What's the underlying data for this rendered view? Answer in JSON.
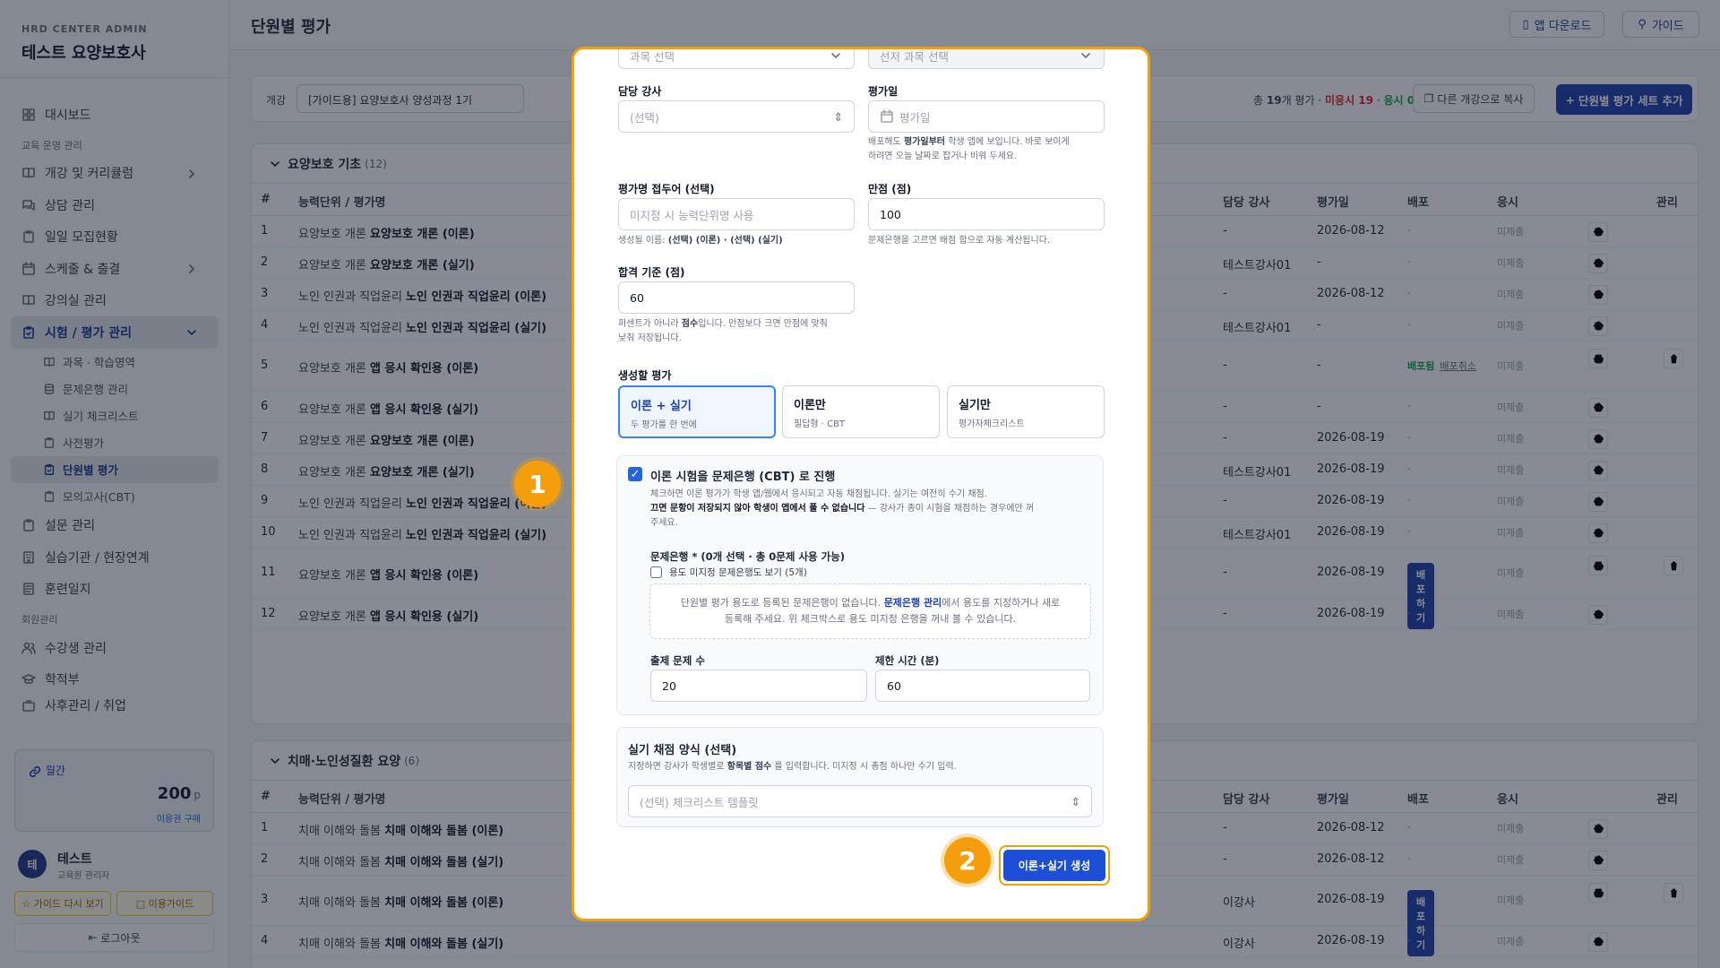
{
  "sidebar": {
    "org": "HRD CENTER ADMIN",
    "title": "테스트 요양보호사",
    "items": {
      "dashboard": "대시보드",
      "sec_edu": "교육 운영 관리",
      "curriculum": "개강 및 커리큘럼",
      "consult": "상담 관리",
      "recruit": "일일 모집현황",
      "schedule": "스케줄 & 출결",
      "classroom": "강의실 관리",
      "exam": "시험 / 평가 관리",
      "sub_subject": "과목 · 학습영역",
      "sub_bank": "문제은행 관리",
      "sub_checklist": "실기 체크리스트",
      "sub_pre": "사전평가",
      "sub_unit": "단원별 평가",
      "sub_mock": "모의고사(CBT)",
      "survey": "설문 관리",
      "practice": "실습기관 / 현장연계",
      "training_log": "훈련일지",
      "sec_member": "회원관리",
      "students": "수강생 관리",
      "records": "학적부",
      "after": "사후관리 / 취업"
    },
    "credit": {
      "label": "월간",
      "value": "200",
      "unit": "p",
      "buy": "이용권 구매"
    },
    "user": {
      "avatar": "테",
      "name": "테스트",
      "role": "교육원 관리자"
    },
    "guide_again": "가이드 다시 보기",
    "usage_guide": "이용가이드",
    "logout": "로그아웃"
  },
  "header": {
    "title": "단원별 평가",
    "app_download": "앱 다운로드",
    "guide": "가이드"
  },
  "filter": {
    "label": "개강",
    "value": "[가이드용] 요양보호사 양성과정 1기",
    "stats_prefix": "총",
    "stats_total": "19",
    "stats_unit": "개 평가 ·",
    "stats_unapplied": "미응시 19",
    "stats_dot": "·",
    "stats_applied": "응시 0",
    "copy_btn": "다른 개강으로 복사",
    "add_btn": "단원별 평가 세트 추가"
  },
  "table_headers": {
    "num": "#",
    "name": "능력단위 / 평가명",
    "teacher": "담당 강사",
    "date": "평가일",
    "dist": "배포",
    "apply": "응시",
    "manage": "관리"
  },
  "section1": {
    "title": "요양보호 기초",
    "count": "(12)",
    "rows": [
      {
        "num": "1",
        "unit": "요양보호 개론",
        "name": "요양보호 개론 (이론)",
        "teacher": "-",
        "date": "2026-08-12",
        "dist": "-",
        "apply": "미제출"
      },
      {
        "num": "2",
        "unit": "요양보호 개론",
        "name": "요양보호 개론 (실기)",
        "teacher": "테스트강사01",
        "date": "-",
        "dist": "-",
        "apply": "미제출"
      },
      {
        "num": "3",
        "unit": "노인 인권과 직업윤리",
        "name": "노인 인권과 직업윤리 (이론)",
        "teacher": "-",
        "date": "2026-08-12",
        "dist": "-",
        "apply": "미제출"
      },
      {
        "num": "4",
        "unit": "노인 인권과 직업윤리",
        "name": "노인 인권과 직업윤리 (실기)",
        "teacher": "테스트강사01",
        "date": "-",
        "dist": "-",
        "apply": "미제출"
      },
      {
        "num": "5",
        "unit": "요양보호 개론",
        "name": "앱 응시 확인용 (이론)",
        "teacher": "-",
        "date": "-",
        "dist": "배포됨",
        "dist_cancel": "배포취소",
        "apply": "미제출"
      },
      {
        "num": "6",
        "unit": "요양보호 개론",
        "name": "앱 응시 확인용 (실기)",
        "teacher": "-",
        "date": "-",
        "dist": "-",
        "apply": "미제출"
      },
      {
        "num": "7",
        "unit": "요양보호 개론",
        "name": "요양보호 개론 (이론)",
        "teacher": "-",
        "date": "2026-08-19",
        "dist": "-",
        "apply": "미제출"
      },
      {
        "num": "8",
        "unit": "요양보호 개론",
        "name": "요양보호 개론 (실기)",
        "teacher": "테스트강사01",
        "date": "2026-08-19",
        "dist": "-",
        "apply": "미제출"
      },
      {
        "num": "9",
        "unit": "노인 인권과 직업윤리",
        "name": "노인 인권과 직업윤리 (이론)",
        "teacher": "-",
        "date": "2026-08-19",
        "dist": "-",
        "apply": "미제출"
      },
      {
        "num": "10",
        "unit": "노인 인권과 직업윤리",
        "name": "노인 인권과 직업윤리 (실기)",
        "teacher": "테스트강사01",
        "date": "2026-08-19",
        "dist": "-",
        "apply": "미제출"
      },
      {
        "num": "11",
        "unit": "요양보호 개론",
        "name": "앱 응시 확인용 (이론)",
        "teacher": "-",
        "date": "2026-08-19",
        "dist": "배포하기",
        "apply": "미제출"
      },
      {
        "num": "12",
        "unit": "요양보호 개론",
        "name": "앱 응시 확인용 (실기)",
        "teacher": "-",
        "date": "2026-08-19",
        "dist": "-",
        "apply": "미제출"
      }
    ]
  },
  "section2": {
    "title": "치매·노인성질환 요양",
    "count": "(6)",
    "rows": [
      {
        "num": "1",
        "unit": "치매 이해와 돌봄",
        "name": "치매 이해와 돌봄 (이론)",
        "teacher": "-",
        "date": "2026-08-12",
        "dist": "-",
        "apply": "미제출"
      },
      {
        "num": "2",
        "unit": "치매 이해와 돌봄",
        "name": "치매 이해와 돌봄 (실기)",
        "teacher": "-",
        "date": "2026-08-12",
        "dist": "-",
        "apply": "미제출"
      },
      {
        "num": "3",
        "unit": "치매 이해와 돌봄",
        "name": "치매 이해와 돌봄 (이론)",
        "teacher": "이강사",
        "date": "2026-08-19",
        "dist": "배포하기",
        "apply": "미제출"
      },
      {
        "num": "4",
        "unit": "치매 이해와 돌봄",
        "name": "치매 이해와 돌봄 (실기)",
        "teacher": "이강사",
        "date": "2026-08-19",
        "dist": "-",
        "apply": "미제출"
      }
    ]
  },
  "modal": {
    "subject_select": "과목 선택",
    "prereq_select": "선저 과목 선택",
    "teacher_label": "담당 강사",
    "teacher_placeholder": "(선택)",
    "date_label": "평가일",
    "date_placeholder": "평가일",
    "date_help1_a": "배포해도",
    "date_help1_b": "평가일부터",
    "date_help1_c": "학생 앱에 보입니다. 바로 보이게",
    "date_help2": "하려면 오늘 날짜로 잡거나 비워 두세요.",
    "prefix_label": "평가명 접두어 (선택)",
    "prefix_placeholder": "미지정 시 능력단위명 사용",
    "prefix_help_a": "생성될 이름:",
    "prefix_help_b": "(선택) (이론) · (선택) (실기)",
    "score_label": "만점 (점)",
    "score_value": "100",
    "score_help": "문제은행을 고르면 배점 합으로 자동 계산됩니다.",
    "pass_label": "합격 기준 (점)",
    "pass_value": "60",
    "pass_help1_a": "퍼센트가 아니라",
    "pass_help1_b": "점수",
    "pass_help1_c": "입니다. 만점보다 크면 만점에 맞춰",
    "pass_help2": "낮춰 저장됩니다.",
    "gen_label": "생성할 평가",
    "gen_options": [
      {
        "title": "이론 + 실기",
        "sub": "두 평가를 한 번에"
      },
      {
        "title": "이론만",
        "sub": "필답형 · CBT"
      },
      {
        "title": "실기만",
        "sub": "평가자체크리스트"
      }
    ],
    "cbt_title": "이론 시험을 문제은행 (CBT) 로 진행",
    "cbt_desc1": "체크하면 이론 평가가 학생 앱/웹에서 응시되고 자동 채점됩니다. 실기는 여전히 수기 채점.",
    "cbt_desc2_b": "끄면 문항이 저장되지 않아 학생이 앱에서 풀 수 없습니다",
    "cbt_desc2_c": "— 강사가 종이 시험을 채점하는 경우에만 꺼",
    "cbt_desc3": "주세요.",
    "bank_label": "문제은행 * (0개 선택 · 총 0문제 사용 가능)",
    "bank_show_unassigned": "용도 미지정 문제은행도 보기 (5개)",
    "bank_empty1_a": "단원별 평가 용도로 등록된 문제은행이 없습니다.",
    "bank_empty1_b": "문제은행 관리",
    "bank_empty1_c": "에서 용도를 지정하거나 새로",
    "bank_empty2": "등록해 주세요. 위 체크박스로 용도 미지정 은행을 꺼내 볼 수 있습니다.",
    "qcount_label": "출제 문제 수",
    "qcount_value": "20",
    "time_label": "제한 시간 (분)",
    "time_value": "60",
    "prac_title": "실기 채점 양식 (선택)",
    "prac_desc_a": "지정하면 강사가 학생별로",
    "prac_desc_b": "항목별 점수",
    "prac_desc_c": "를 입력합니다. 미지정 시 총점 하나만 수기 입력.",
    "prac_placeholder": "(선택) 체크리스트 템플릿",
    "create_btn": "이론+실기 생성"
  },
  "markers": {
    "one": "1",
    "two": "2"
  },
  "colors": {
    "accent": "#1e40af",
    "highlight": "#f59e0b",
    "danger": "#dc2626",
    "success": "#16a34a"
  }
}
